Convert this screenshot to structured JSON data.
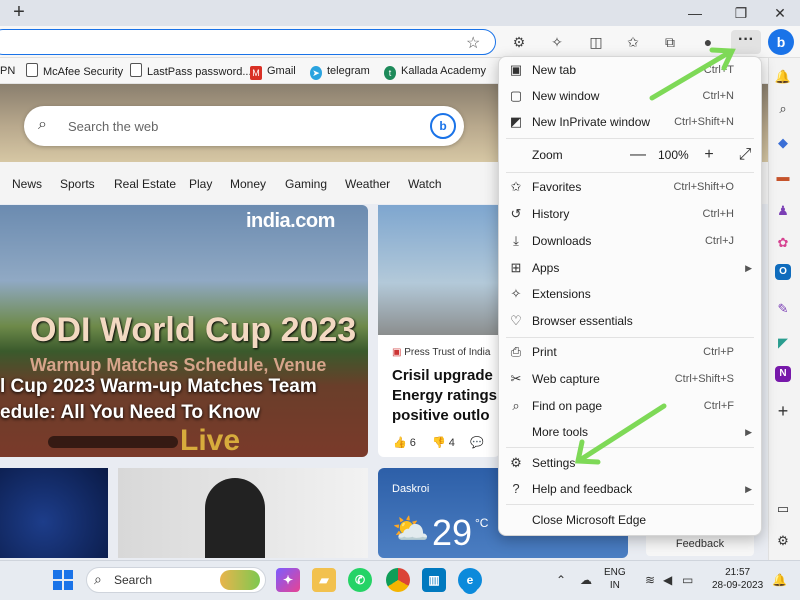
{
  "browser": {
    "new_tab_icon": "plus-icon",
    "window_controls": [
      "minimize-icon",
      "restore-icon",
      "close-icon"
    ],
    "more_button": "···",
    "favorites": [
      {
        "label": "PN",
        "icon": "page-icon",
        "color": "#555555"
      },
      {
        "label": "McAfee Security",
        "icon": "page-icon",
        "color": "#555555"
      },
      {
        "label": "LastPass password...",
        "icon": "page-icon",
        "color": "#555555"
      },
      {
        "label": "Gmail",
        "icon": "gmail-icon",
        "color": "#d93025"
      },
      {
        "label": "telegram",
        "icon": "telegram-icon",
        "color": "#2aa3df"
      },
      {
        "label": "Kallada Academy",
        "icon": "kallada-icon",
        "color": "#1e8a5a"
      }
    ]
  },
  "page": {
    "search_placeholder": "Search the web",
    "nav": [
      "News",
      "Sports",
      "Real Estate",
      "Play",
      "Money",
      "Gaming",
      "Weather",
      "Watch"
    ],
    "main_story": {
      "source_logo": "india.com",
      "image_title": "ODI World Cup 2023",
      "image_subtitle": "Warmup Matches Schedule, Venue",
      "headline_line1": "l Cup 2023 Warm-up Matches Team",
      "headline_line2": "edule: All You Need To Know",
      "image_overlay": "Live"
    },
    "side_story": {
      "source": "Press Trust of India",
      "headline": "Crisil upgrade Energy ratings positive outlo",
      "likes": "6",
      "dislikes": "4"
    },
    "weather": {
      "location": "Daskroi",
      "temp": "29",
      "unit": "°C"
    },
    "feedback": "Feedback"
  },
  "menu": {
    "items": [
      {
        "label": "New tab",
        "shortcut": "Ctrl+T",
        "icon": "new-tab-icon"
      },
      {
        "label": "New window",
        "shortcut": "Ctrl+N",
        "icon": "new-window-icon"
      },
      {
        "label": "New InPrivate window",
        "shortcut": "Ctrl+Shift+N",
        "icon": "inprivate-icon"
      }
    ],
    "zoom": {
      "label": "Zoom",
      "value": "100%",
      "minus": "—",
      "plus": "+"
    },
    "items2": [
      {
        "label": "Favorites",
        "shortcut": "Ctrl+Shift+O",
        "icon": "favorites-icon"
      },
      {
        "label": "History",
        "shortcut": "Ctrl+H",
        "icon": "history-icon"
      },
      {
        "label": "Downloads",
        "shortcut": "Ctrl+J",
        "icon": "download-icon"
      },
      {
        "label": "Apps",
        "shortcut": "",
        "icon": "apps-icon",
        "submenu": true
      },
      {
        "label": "Extensions",
        "shortcut": "",
        "icon": "extensions-icon"
      },
      {
        "label": "Browser essentials",
        "shortcut": "",
        "icon": "heart-pulse-icon"
      }
    ],
    "items3": [
      {
        "label": "Print",
        "shortcut": "Ctrl+P",
        "icon": "print-icon"
      },
      {
        "label": "Web capture",
        "shortcut": "Ctrl+Shift+S",
        "icon": "web-capture-icon"
      },
      {
        "label": "Find on page",
        "shortcut": "Ctrl+F",
        "icon": "find-icon"
      },
      {
        "label": "More tools",
        "shortcut": "",
        "icon": "",
        "submenu": true
      }
    ],
    "items4": [
      {
        "label": "Settings",
        "shortcut": "",
        "icon": "gear-icon"
      },
      {
        "label": "Help and feedback",
        "shortcut": "",
        "icon": "help-icon",
        "submenu": true
      }
    ],
    "close_label": "Close Microsoft Edge"
  },
  "taskbar": {
    "search_label": "Search",
    "lang_line1": "ENG",
    "lang_line2": "IN",
    "time": "21:57",
    "date": "28-09-2023"
  },
  "colors": {
    "annotation_arrow": "#7ed957",
    "accent": "#1a73e8"
  }
}
